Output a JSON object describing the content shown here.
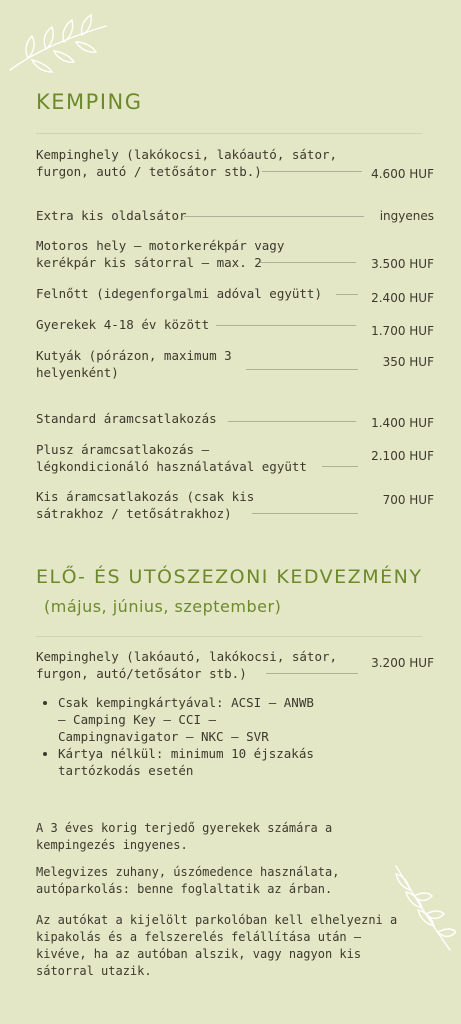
{
  "kemping": {
    "title": "KEMPING",
    "rows": [
      {
        "label1": "Kempinghely (lakókocsi, lakóautó, sátor,",
        "label2": "furgon, autó / tetősátor stb.)",
        "price": "4.600 HUF"
      },
      {
        "label1": "Extra kis oldalsátor",
        "price": "ingyenes"
      },
      {
        "label1": "Motoros hely – motorkerékpár vagy",
        "label2": "kerékpár kis sátorral – max. 2",
        "price": "3.500 HUF"
      },
      {
        "label1": "Felnőtt (idegenforgalmi adóval együtt)",
        "price": "2.400 HUF"
      },
      {
        "label1": "Gyerekek 4-18 év között",
        "price": "1.700 HUF"
      },
      {
        "label1": "Kutyák (pórázon, maximum 3",
        "label2": "helyenként)",
        "price": "350 HUF"
      },
      {
        "label1": "Standard áramcsatlakozás",
        "price": "1.400 HUF"
      },
      {
        "label1": "Plusz áramcsatlakozás –",
        "label2": "légkondicionáló használatával együtt",
        "price": "2.100 HUF"
      },
      {
        "label1": "Kis áramcsatlakozás (csak kis",
        "label2": "sátrakhoz / tetősátrakhoz)",
        "price": "700 HUF"
      }
    ]
  },
  "season": {
    "title": "ELŐ- ÉS UTÓSZEZONI KEDVEZMÉNY",
    "subtitle": "(május, június, szeptember)",
    "row": {
      "label1": "Kempinghely (lakóautó, lakókocsi, sátor,",
      "label2": "furgon, autó/tetősátor stb.)",
      "price": "3.200 HUF"
    },
    "bullets": [
      {
        "line1": "Csak kempingkártyával: ACSI – ANWB",
        "line2": "– Camping Key – CCI –",
        "line3": "Campingnavigator – NKC – SVR"
      },
      {
        "line1": "Kártya nélkül: minimum 10 éjszakás",
        "line2": "tartózkodás esetén"
      }
    ]
  },
  "notes": [
    {
      "line1": "A 3 éves korig terjedő gyerekek számára a",
      "line2": "kempingezés ingyenes."
    },
    {
      "line1": "Melegvizes zuhany, úszómedence használata,",
      "line2": "autóparkolás: benne foglaltatik az árban."
    },
    {
      "line1": "Az autókat a kijelölt parkolóban kell elhelyezni a",
      "line2": "kipakolás és a felszerelés felállítása után –",
      "line3": "kivéve, ha az autóban alszik, vagy nagyon kis",
      "line4": "sátorral utazik."
    }
  ],
  "colors": {
    "background": "#e3e7c5",
    "heading": "#6d8a2b",
    "text": "#3c3a2e",
    "leaf": "#ffffff"
  },
  "icons": [
    "leaf-branch-icon"
  ]
}
